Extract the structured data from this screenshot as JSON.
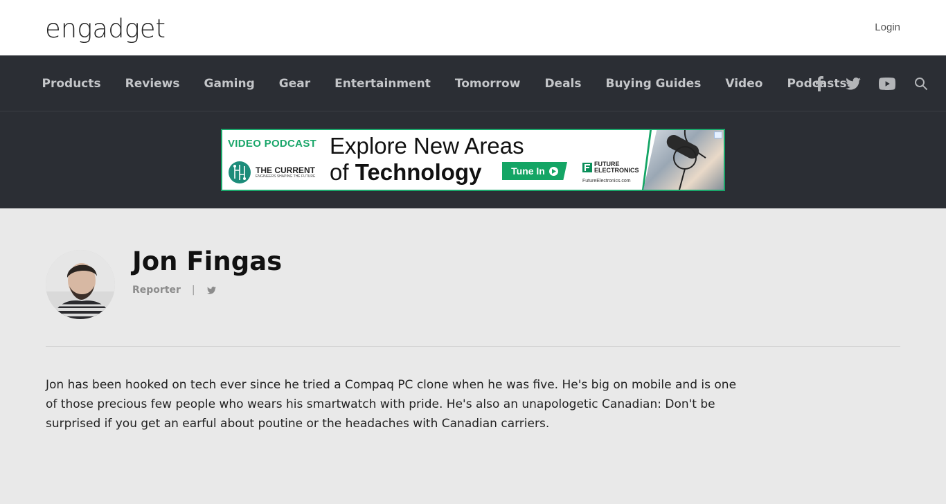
{
  "header": {
    "logo": "engadget",
    "login": "Login"
  },
  "nav": {
    "items": [
      "Products",
      "Reviews",
      "Gaming",
      "Gear",
      "Entertainment",
      "Tomorrow",
      "Deals",
      "Buying Guides",
      "Video",
      "Podcasts"
    ],
    "social_icons": [
      "facebook-icon",
      "twitter-icon",
      "youtube-icon",
      "search-icon"
    ]
  },
  "ad": {
    "tag": "VIDEO PODCAST",
    "brand_name": "THE CURRENT",
    "brand_sub": "ENGINEERS SHAPING THE FUTURE",
    "headline_1": "Explore New Areas",
    "headline_2_pre": "of",
    "headline_2_bold": "Technology",
    "cta": "Tune In",
    "sponsor_name": "FUTURE ELECTRONICS",
    "sponsor_url": "FutureElectronics.com"
  },
  "author": {
    "name": "Jon Fingas",
    "role": "Reporter",
    "separator": "|",
    "bio": "Jon has been hooked on tech ever since he tried a Compaq PC clone when he was five. He's big on mobile and is one of those precious few people who wears his smartwatch with pride. He's also an unapologetic Canadian: Don't be surprised if you get an earful about poutine or the headaches with Canadian carriers."
  },
  "colors": {
    "nav_bg": "#2b2e34",
    "page_bg": "#e9e9e9",
    "accent_green": "#14a565"
  }
}
